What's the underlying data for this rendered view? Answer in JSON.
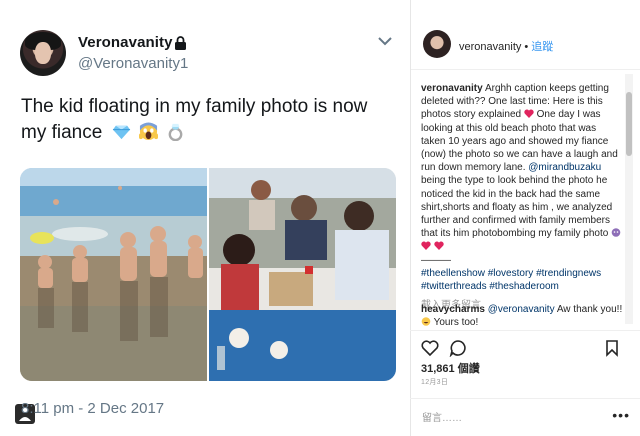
{
  "tweet": {
    "display_name": "Veronavanity",
    "handle": "@Veronavanity1",
    "text": "The kid floating in my family photo is now my fiance",
    "emojis": [
      "gem-icon",
      "screaming-face-icon",
      "ring-icon"
    ],
    "timestamp": "8:11 pm - 2 Dec 2017"
  },
  "instagram": {
    "username": "veronavanity",
    "separator": "•",
    "follow_label": "追蹤",
    "caption_user": "veronavanity",
    "caption_part1": "Arghh caption keeps getting deleted with?? One last time: Here is this photos story explained",
    "caption_part2": "One day I was looking at this old beach photo that was taken 10 years ago and showed my fiance (now) the photo so we can have a laugh and run down memory lane.",
    "mention": "@mirandbuzaku",
    "caption_part3": "being the type to look behind the photo he noticed the kid in the back had the same shirt,shorts and floaty as him , we analyzed further and confirmed with family members that its him photobombing my family photo",
    "dashes": "———",
    "hashtags": "#theellenshow #lovestory #trendingnews #twitterthreads #theshaderoom",
    "more_comments": "載入更多留言",
    "comment_user": "heavycharms",
    "comment_mention": "@veronavanity",
    "comment_text": "Aw thank you!!",
    "comment_text2": "Yours too!",
    "likes": "31,861 個讚",
    "date": "12月3日",
    "add_comment_placeholder": "留言……",
    "more_label": "•••"
  },
  "colors": {
    "accent": "#3897f0",
    "link": "#003569",
    "muted": "#657786"
  }
}
